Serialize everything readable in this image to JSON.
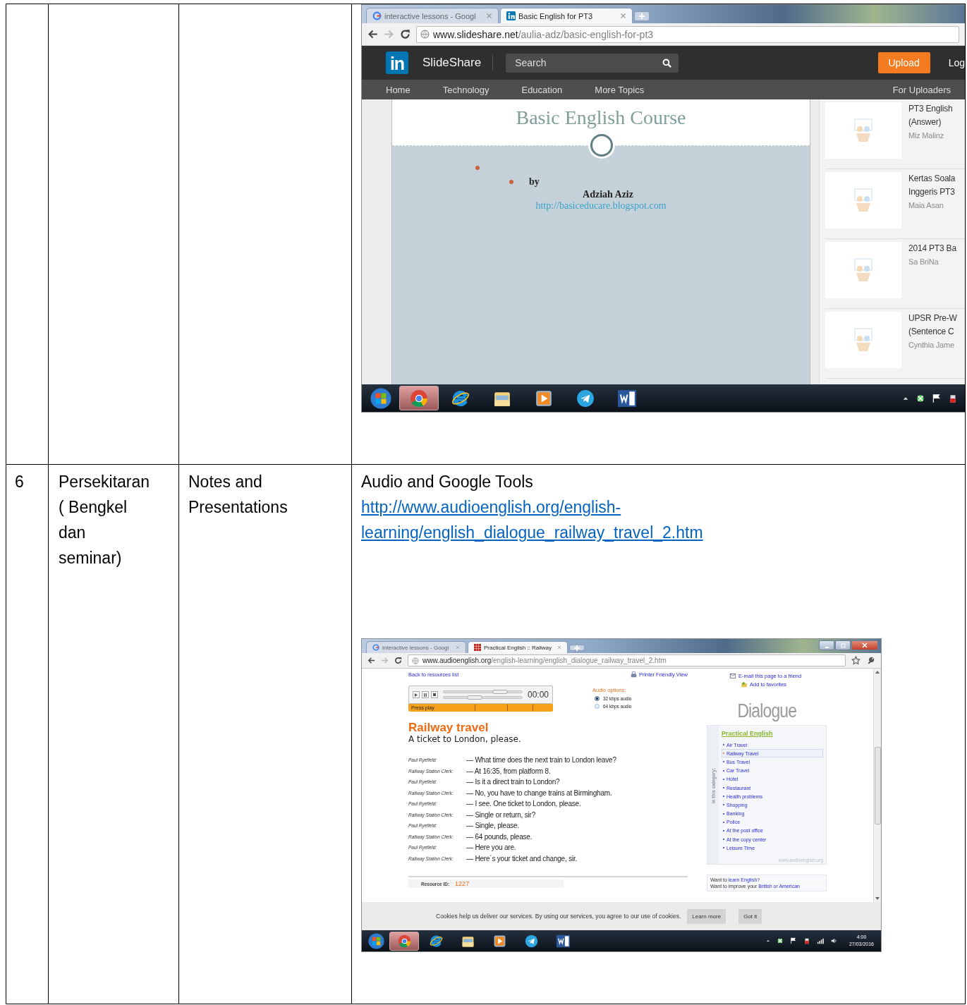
{
  "previous_row": {
    "screenshot": {
      "tabs": [
        {
          "title": "interactive lessons - Googl",
          "kind": "google",
          "selected": false
        },
        {
          "title": "Basic English for PT3",
          "kind": "linkedin",
          "selected": true
        }
      ],
      "url": {
        "domain": "www.slideshare.net",
        "path": "/aulia-adz/basic-english-for-pt3"
      },
      "header": {
        "logo_mark": "in",
        "brand": "SlideShare",
        "search_placeholder": "Search",
        "upload": "Upload",
        "login": "Log"
      },
      "nav": [
        "Home",
        "Technology",
        "Education",
        "More Topics"
      ],
      "nav_right": "For Uploaders",
      "slide": {
        "title": "Basic English Course",
        "by": "by",
        "author": "Adziah Aziz",
        "link": "http://basiceducare.blogspot.com"
      },
      "related": [
        {
          "title_lines": [
            "PT3 English",
            "(Answer)"
          ],
          "author": "Miz Malinz"
        },
        {
          "title_lines": [
            "Kertas Soala",
            "Inggeris PT3"
          ],
          "author": "Maia Asan"
        },
        {
          "title_lines": [
            "2014 PT3 Ba"
          ],
          "author": "Sa BriNa"
        },
        {
          "title_lines": [
            "UPSR Pre-W",
            "(Sentence C"
          ],
          "author": "Cynthia Jame"
        }
      ],
      "taskbar": [
        {
          "kind": "chrome",
          "selected": true
        },
        {
          "kind": "ie",
          "selected": false
        },
        {
          "kind": "folder",
          "selected": false
        },
        {
          "kind": "media",
          "selected": false
        },
        {
          "kind": "telegram",
          "selected": false
        },
        {
          "kind": "word",
          "selected": false
        }
      ]
    }
  },
  "row": {
    "number": "6",
    "area": "Persekitaran ( Bengkel dan seminar)",
    "activity": "Notes and Presentations",
    "title": "Audio and Google Tools",
    "link": "http://www.audioenglish.org/english-learning/english_dialogue_railway_travel_2.htm",
    "screenshot": {
      "tabs": [
        {
          "title": "interactive lessons - Googl",
          "kind": "google",
          "selected": false
        },
        {
          "title": "Practical English :: Railway",
          "kind": "grid",
          "selected": true
        }
      ],
      "url": {
        "domain": "www.audioenglish.org",
        "path": "/english-learning/english_dialogue_railway_travel_2.htm"
      },
      "back_link": "Back to resources list",
      "printer_link": "Printer Friendly View",
      "email_link": "E-mail this page to a friend",
      "favorites_link": "Add to favorites",
      "player": {
        "time": "00:00",
        "status": "Press play"
      },
      "audio_options": {
        "label": "Audio options:",
        "options": [
          {
            "label": "32 kbps audio",
            "selected": true
          },
          {
            "label": "64 kbps audio",
            "selected": false
          }
        ]
      },
      "section_title": "Dialogue",
      "title": "Railway travel",
      "subtitle": "A ticket to London, please.",
      "dialogue": [
        {
          "speaker": "Paul Ryefield:",
          "text": "— What time does the next train to London leave?"
        },
        {
          "speaker": "Railway Station Clerk:",
          "text": "— At 16:35, from platform 8."
        },
        {
          "speaker": "Paul Ryefield:",
          "text": "— Is it a direct train to London?"
        },
        {
          "speaker": "Railway Station Clerk:",
          "text": "— No, you have to change trains at Birmingham."
        },
        {
          "speaker": "Paul Ryefield:",
          "text": "— I see. One ticket to London, please."
        },
        {
          "speaker": "Railway Station Clerk:",
          "text": "— Single or return, sir?"
        },
        {
          "speaker": "Paul Ryefield:",
          "text": "— Single, please."
        },
        {
          "speaker": "Railway Station Clerk:",
          "text": "— 64 pounds, please."
        },
        {
          "speaker": "Paul Ryefield:",
          "text": "— Here you are."
        },
        {
          "speaker": "Railway Station Clerk:",
          "text": "— Here´s your ticket and change, sir."
        }
      ],
      "category": {
        "side_label": "In this category:",
        "heading": "Practical English",
        "items": [
          {
            "label": "Air Travel",
            "selected": false
          },
          {
            "label": "Railway Travel",
            "selected": true
          },
          {
            "label": "Bus Travel",
            "selected": false
          },
          {
            "label": "Car Travel",
            "selected": false
          },
          {
            "label": "Hotel",
            "selected": false
          },
          {
            "label": "Restaurant",
            "selected": false
          },
          {
            "label": "Health problems",
            "selected": false
          },
          {
            "label": "Shopping",
            "selected": false
          },
          {
            "label": "Banking",
            "selected": false
          },
          {
            "label": "Police",
            "selected": false
          },
          {
            "label": "At the post office",
            "selected": false
          },
          {
            "label": "At the copy center",
            "selected": false
          },
          {
            "label": "Leisure Time",
            "selected": false
          }
        ],
        "site": "www.audioenglish.org"
      },
      "resource": {
        "label": "Resource ID:",
        "value": "1227"
      },
      "promo": [
        {
          "before": "Want to ",
          "link": "learn English",
          "after": "?"
        },
        {
          "before": "Want to improve your ",
          "link": "British or American"
        }
      ],
      "cookie": {
        "text": "Cookies help us deliver our services. By using our services, you agree to our use of cookies.",
        "learn_more": "Learn more",
        "got_it": "Got it"
      },
      "taskbar": [
        {
          "kind": "chrome",
          "selected": true
        },
        {
          "kind": "ie",
          "selected": false
        },
        {
          "kind": "folder",
          "selected": false
        },
        {
          "kind": "media",
          "selected": false
        },
        {
          "kind": "telegram",
          "selected": false
        },
        {
          "kind": "word",
          "selected": false
        }
      ],
      "clock": {
        "time": "4:00",
        "date": "27/03/2016"
      }
    }
  }
}
